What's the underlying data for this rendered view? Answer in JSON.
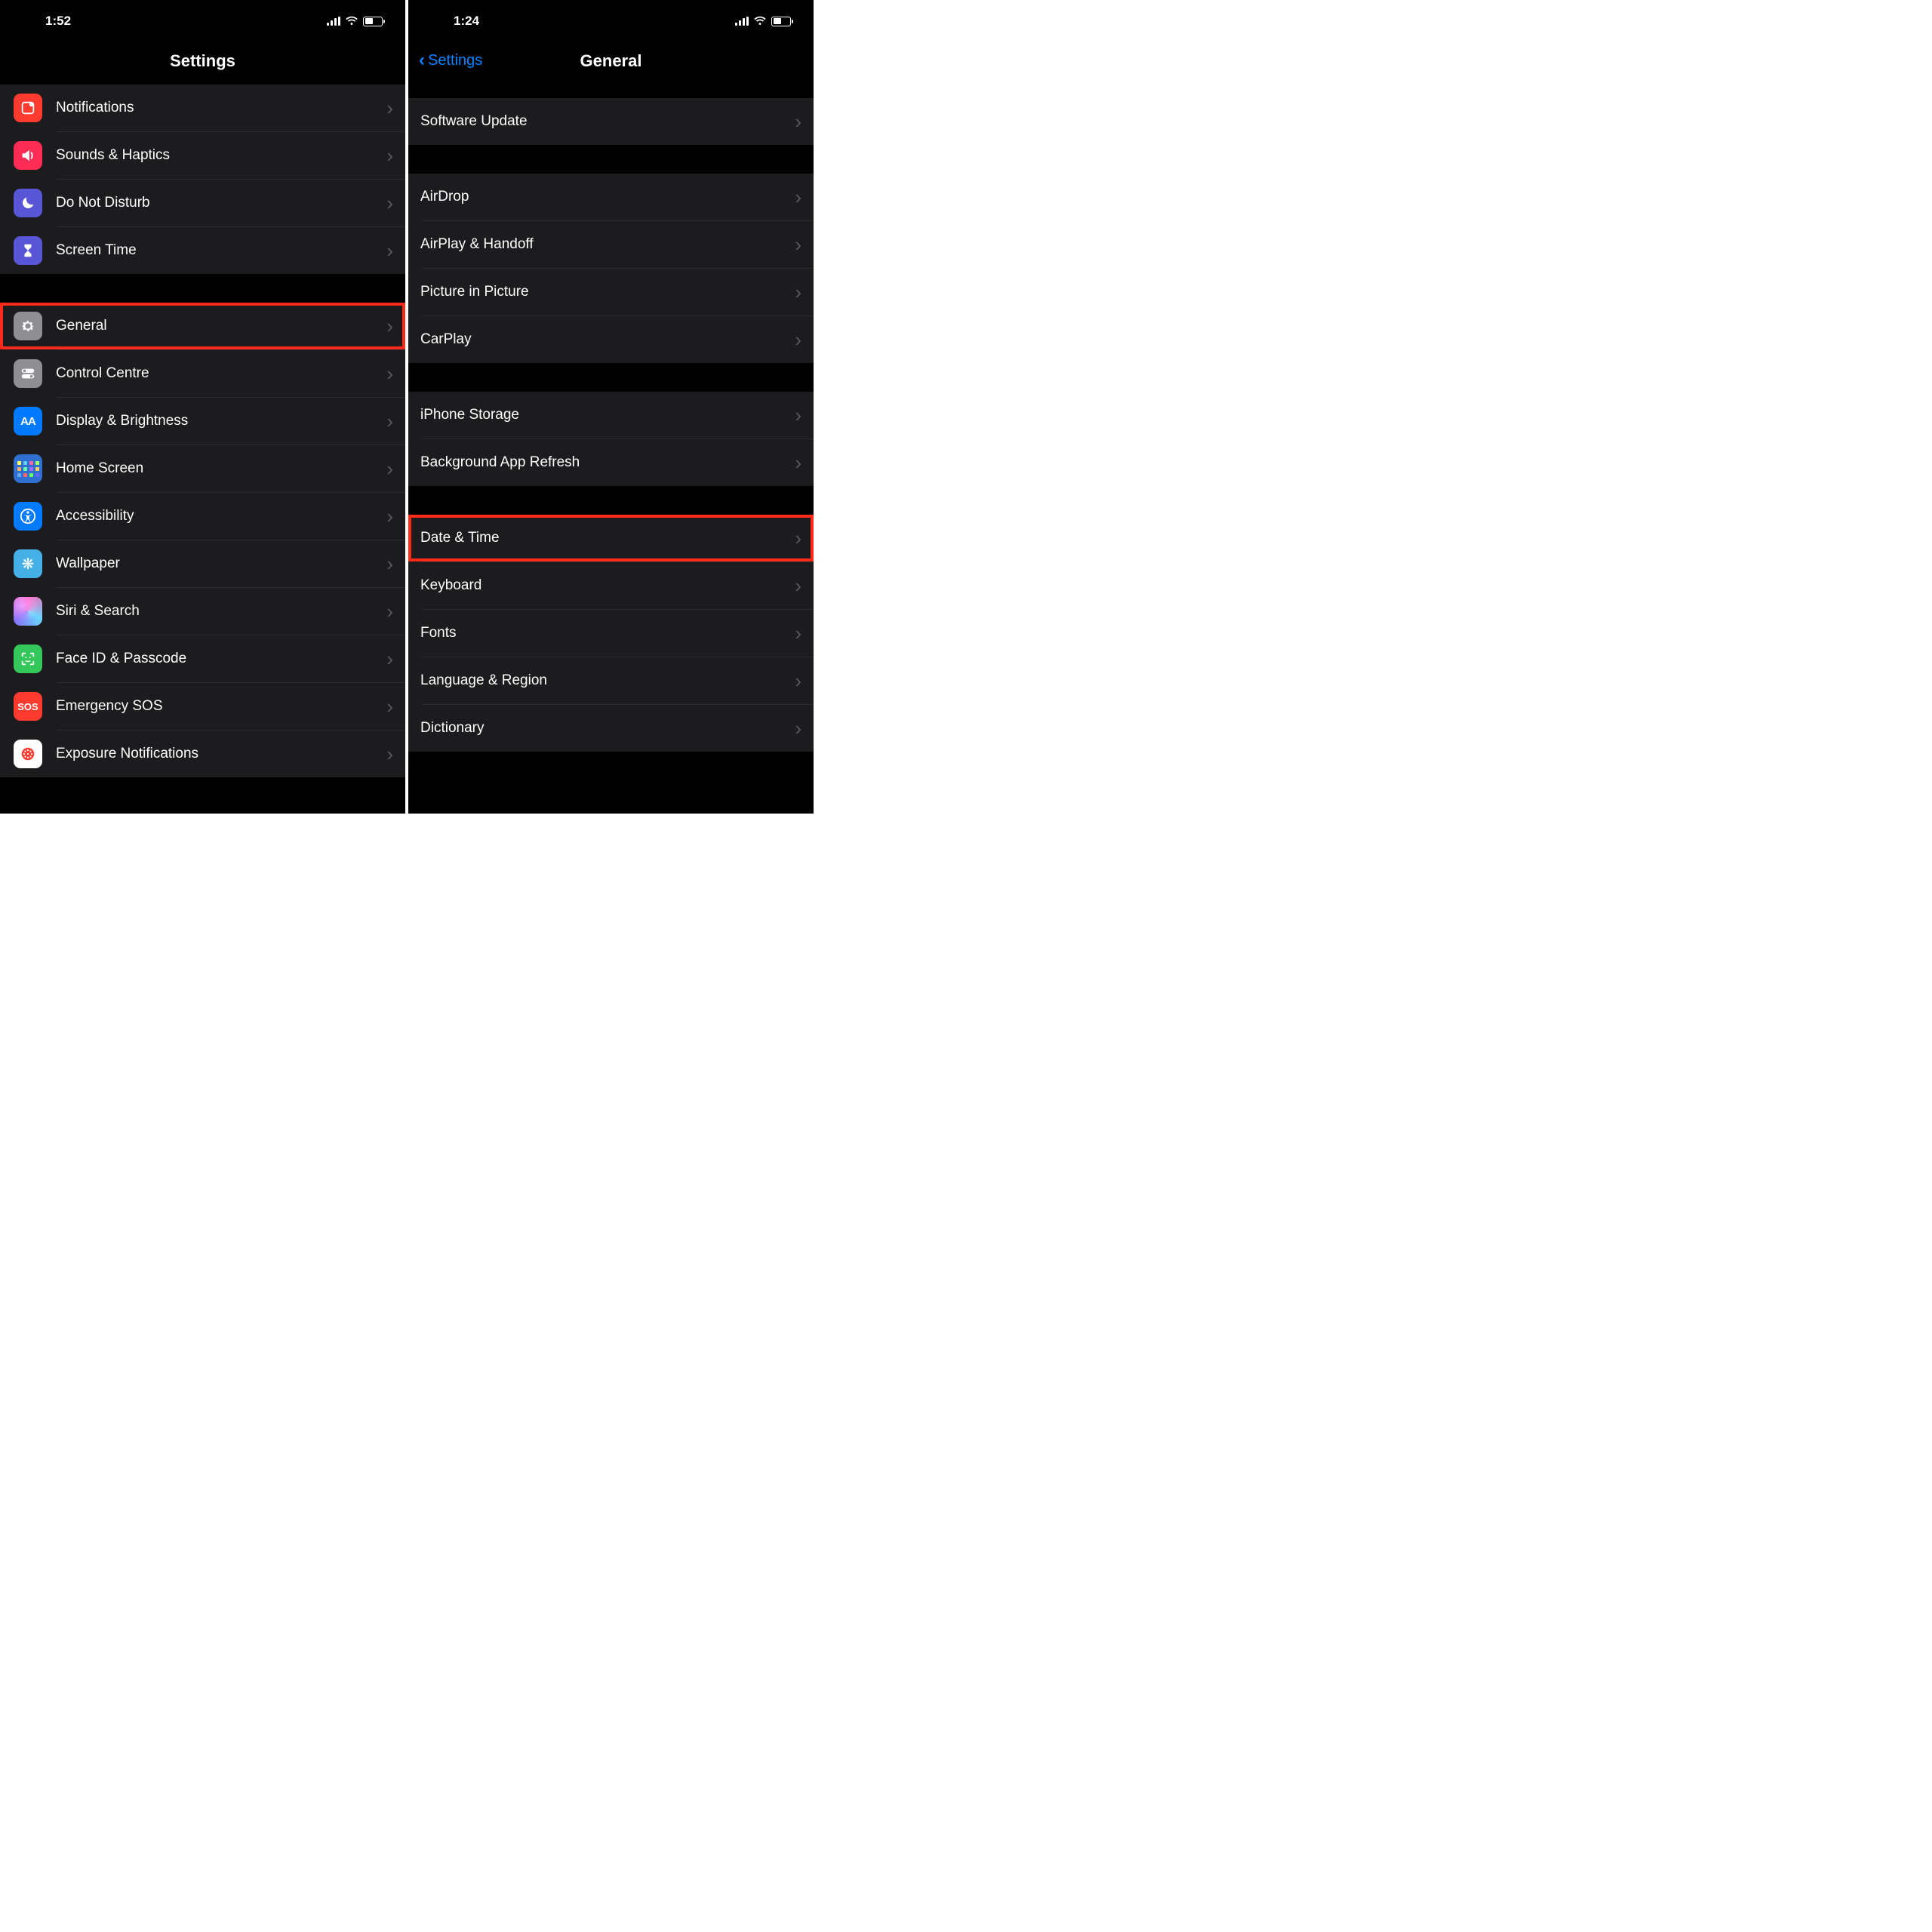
{
  "left": {
    "status_time": "1:52",
    "nav_title": "Settings",
    "groups": [
      [
        {
          "key": "notifications",
          "label": "Notifications",
          "icon": "notifications-icon",
          "bg": "bg-red"
        },
        {
          "key": "sounds",
          "label": "Sounds & Haptics",
          "icon": "speaker-icon",
          "bg": "bg-pink"
        },
        {
          "key": "dnd",
          "label": "Do Not Disturb",
          "icon": "moon-icon",
          "bg": "bg-purple"
        },
        {
          "key": "screentime",
          "label": "Screen Time",
          "icon": "hourglass-icon",
          "bg": "bg-purple"
        }
      ],
      [
        {
          "key": "general",
          "label": "General",
          "icon": "gear-icon",
          "bg": "bg-gray",
          "highlight": true
        },
        {
          "key": "control",
          "label": "Control Centre",
          "icon": "toggles-icon",
          "bg": "bg-gray"
        },
        {
          "key": "display",
          "label": "Display & Brightness",
          "icon": "aa-icon",
          "bg": "bg-blue"
        },
        {
          "key": "home",
          "label": "Home Screen",
          "icon": "grid-icon",
          "bg": "bg-bluedk"
        },
        {
          "key": "accessibility",
          "label": "Accessibility",
          "icon": "accessibility-icon",
          "bg": "bg-blue"
        },
        {
          "key": "wallpaper",
          "label": "Wallpaper",
          "icon": "flower-icon",
          "bg": "bg-blue"
        },
        {
          "key": "siri",
          "label": "Siri & Search",
          "icon": "siri-icon",
          "bg": "bg-black"
        },
        {
          "key": "faceid",
          "label": "Face ID & Passcode",
          "icon": "faceid-icon",
          "bg": "bg-green"
        },
        {
          "key": "sos",
          "label": "Emergency SOS",
          "icon": "sos-icon",
          "bg": "bg-red"
        },
        {
          "key": "exposure",
          "label": "Exposure Notifications",
          "icon": "exposure-icon",
          "bg": "bg-red"
        }
      ]
    ]
  },
  "right": {
    "status_time": "1:24",
    "back_label": "Settings",
    "nav_title": "General",
    "groups": [
      [
        {
          "key": "software",
          "label": "Software Update"
        }
      ],
      [
        {
          "key": "airdrop",
          "label": "AirDrop"
        },
        {
          "key": "airplay",
          "label": "AirPlay & Handoff"
        },
        {
          "key": "pip",
          "label": "Picture in Picture"
        },
        {
          "key": "carplay",
          "label": "CarPlay"
        }
      ],
      [
        {
          "key": "storage",
          "label": "iPhone Storage"
        },
        {
          "key": "bgrefresh",
          "label": "Background App Refresh"
        }
      ],
      [
        {
          "key": "datetime",
          "label": "Date & Time",
          "highlight": true
        },
        {
          "key": "keyboard",
          "label": "Keyboard"
        },
        {
          "key": "fonts",
          "label": "Fonts"
        },
        {
          "key": "lang",
          "label": "Language & Region"
        },
        {
          "key": "dict",
          "label": "Dictionary"
        }
      ]
    ]
  }
}
